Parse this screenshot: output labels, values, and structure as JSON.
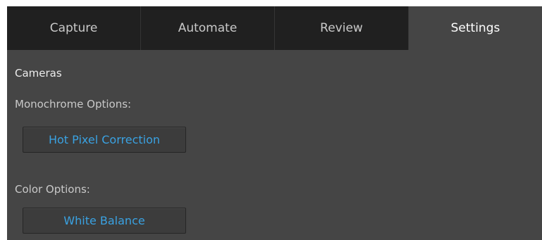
{
  "tabs": [
    {
      "label": "Capture"
    },
    {
      "label": "Automate"
    },
    {
      "label": "Review"
    },
    {
      "label": "Settings"
    }
  ],
  "active_tab": "Settings",
  "settings": {
    "section_title": "Cameras",
    "monochrome": {
      "label": "Monochrome Options:",
      "button_label": "Hot Pixel Correction"
    },
    "color": {
      "label": "Color Options:",
      "button_label": "White Balance"
    }
  },
  "colors": {
    "tabbar_bg": "#202020",
    "panel_bg": "#454545",
    "accent_text": "#3aa2e2"
  }
}
